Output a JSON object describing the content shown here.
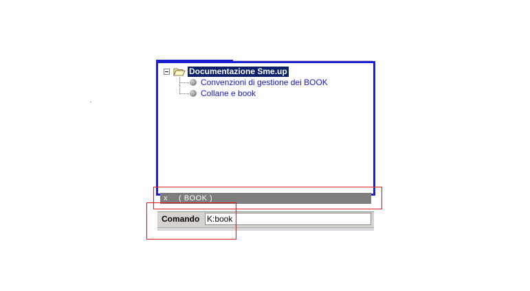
{
  "tree": {
    "root": {
      "label": "Documentazione Sme.up",
      "icon": "folder-open-icon",
      "expanded": true,
      "children": [
        {
          "label": "Convenzioni di gestione dei BOOK",
          "icon": "gray-ball-icon"
        },
        {
          "label": "Collane e book",
          "icon": "gray-ball-icon"
        }
      ]
    }
  },
  "status_bar": {
    "close_label": "x",
    "text": "( BOOK )"
  },
  "command": {
    "label": "Comando",
    "value": "K:book"
  },
  "colors": {
    "panel_border": "#1c1cd4",
    "selection_bg": "#0c1f6b",
    "link_text": "#1414c8",
    "status_bg": "#7d7d7d",
    "command_bg": "#d6d3ce",
    "annotation_red": "#e8141e"
  }
}
